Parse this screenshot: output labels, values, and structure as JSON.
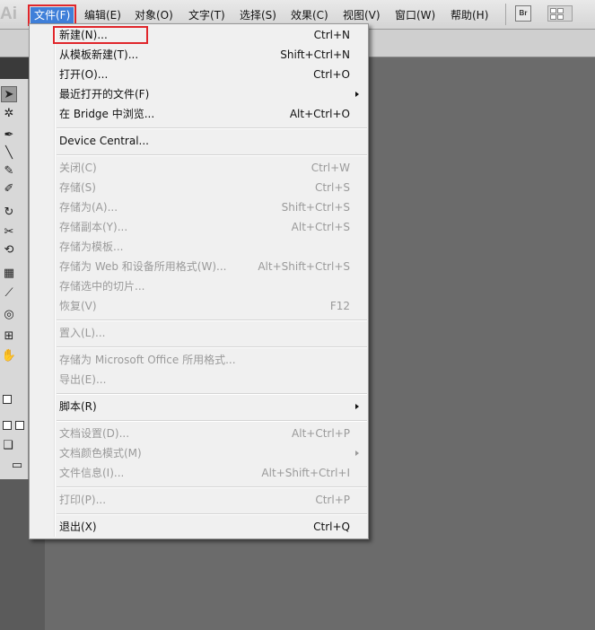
{
  "app": {
    "logo_text": "Ai"
  },
  "menubar": {
    "items": [
      {
        "label": "文件(F)"
      },
      {
        "label": "编辑(E)"
      },
      {
        "label": "对象(O)"
      },
      {
        "label": "文字(T)"
      },
      {
        "label": "选择(S)"
      },
      {
        "label": "效果(C)"
      },
      {
        "label": "视图(V)"
      },
      {
        "label": "窗口(W)"
      },
      {
        "label": "帮助(H)"
      }
    ],
    "bridge_button": "Br"
  },
  "colors": {
    "highlight": "#e0262b",
    "active_menu": "#3f7fd9",
    "disabled_text": "#9a9a9a"
  },
  "file_menu": {
    "items": [
      {
        "label": "新建(N)...",
        "shortcut": "Ctrl+N",
        "disabled": false
      },
      {
        "label": "从模板新建(T)...",
        "shortcut": "Shift+Ctrl+N",
        "disabled": false
      },
      {
        "label": "打开(O)...",
        "shortcut": "Ctrl+O",
        "disabled": false
      },
      {
        "label": "最近打开的文件(F)",
        "shortcut": "",
        "submenu": true,
        "disabled": false
      },
      {
        "label": "在 Bridge 中浏览...",
        "shortcut": "Alt+Ctrl+O",
        "disabled": false
      },
      {
        "label": "Device Central...",
        "shortcut": "",
        "disabled": false
      },
      {
        "label": "关闭(C)",
        "shortcut": "Ctrl+W",
        "disabled": true
      },
      {
        "label": "存储(S)",
        "shortcut": "Ctrl+S",
        "disabled": true
      },
      {
        "label": "存储为(A)...",
        "shortcut": "Shift+Ctrl+S",
        "disabled": true
      },
      {
        "label": "存储副本(Y)...",
        "shortcut": "Alt+Ctrl+S",
        "disabled": true
      },
      {
        "label": "存储为模板...",
        "shortcut": "",
        "disabled": true
      },
      {
        "label": "存储为 Web 和设备所用格式(W)...",
        "shortcut": "Alt+Shift+Ctrl+S",
        "disabled": true
      },
      {
        "label": "存储选中的切片...",
        "shortcut": "",
        "disabled": true
      },
      {
        "label": "恢复(V)",
        "shortcut": "F12",
        "disabled": true
      },
      {
        "label": "置入(L)...",
        "shortcut": "",
        "disabled": true
      },
      {
        "label": "存储为 Microsoft Office 所用格式...",
        "shortcut": "",
        "disabled": true
      },
      {
        "label": "导出(E)...",
        "shortcut": "",
        "disabled": true
      },
      {
        "label": "脚本(R)",
        "shortcut": "",
        "submenu": true,
        "disabled": false
      },
      {
        "label": "文档设置(D)...",
        "shortcut": "Alt+Ctrl+P",
        "disabled": true
      },
      {
        "label": "文档颜色模式(M)",
        "shortcut": "",
        "submenu": true,
        "disabled": true
      },
      {
        "label": "文件信息(I)...",
        "shortcut": "Alt+Shift+Ctrl+I",
        "disabled": true
      },
      {
        "label": "打印(P)...",
        "shortcut": "Ctrl+P",
        "disabled": true
      },
      {
        "label": "退出(X)",
        "shortcut": "Ctrl+Q",
        "disabled": false
      }
    ]
  }
}
